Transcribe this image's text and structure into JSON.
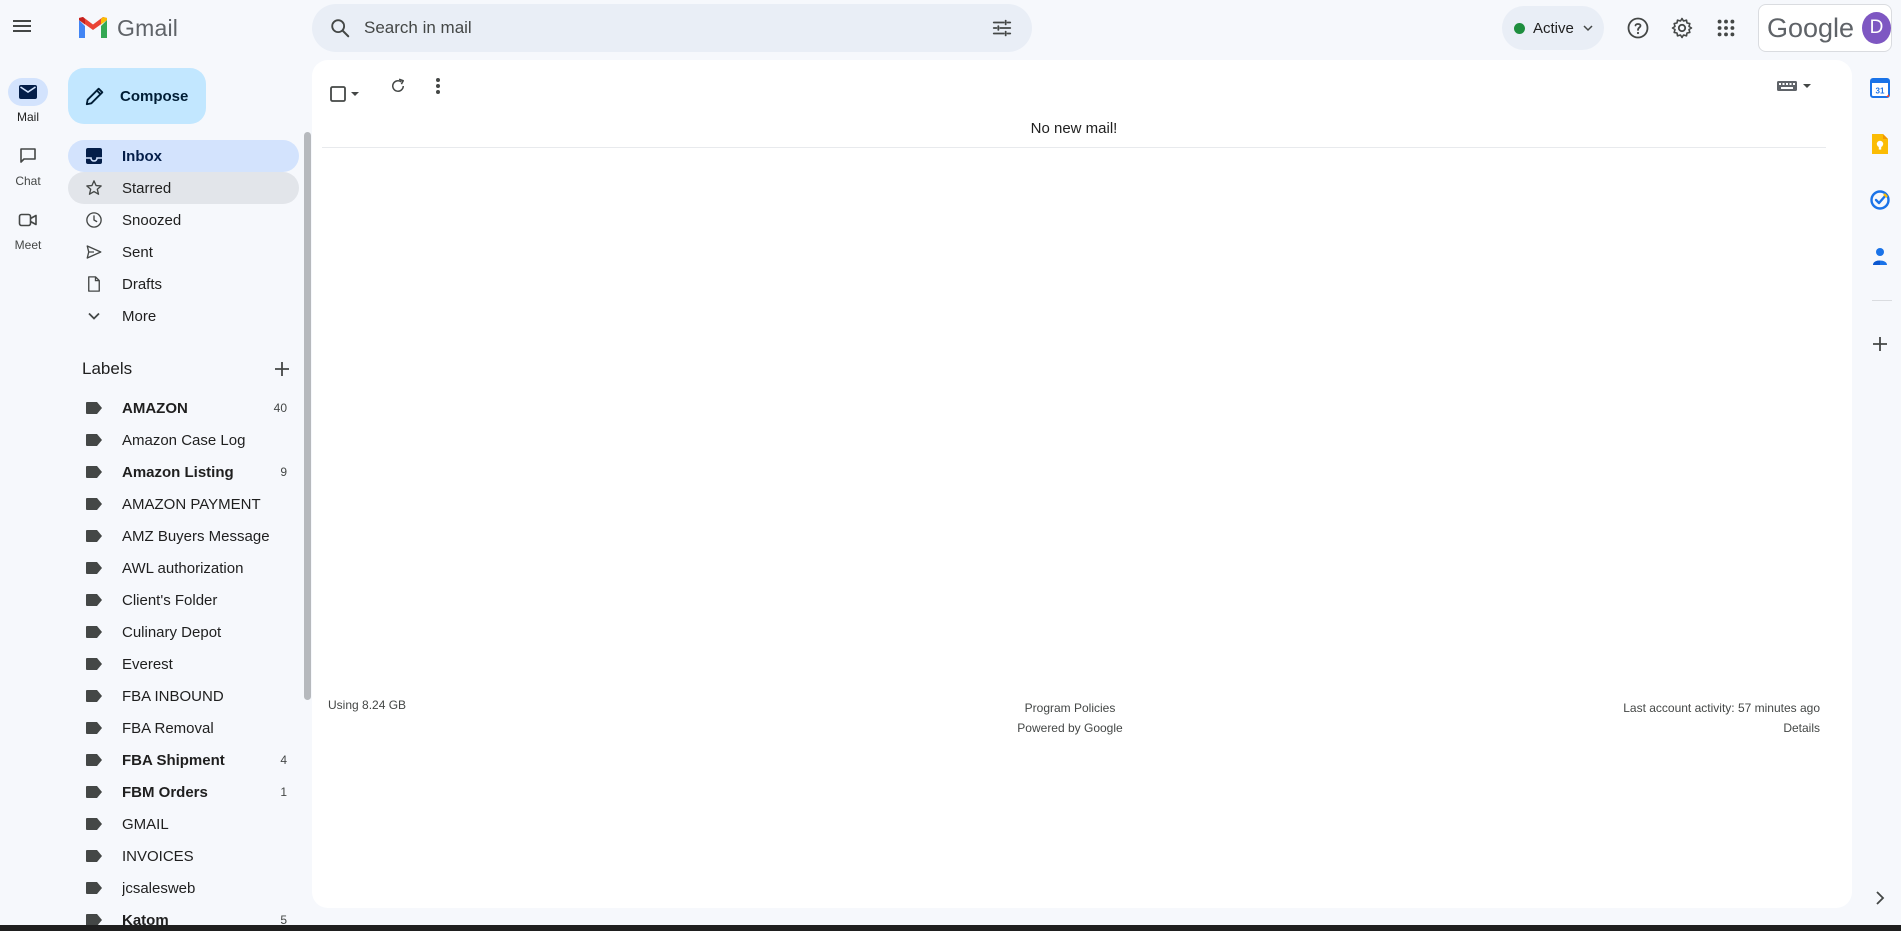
{
  "header": {
    "app_name": "Gmail",
    "search_placeholder": "Search in mail",
    "status_label": "Active",
    "google_wordmark": "Google",
    "avatar_initial": "D"
  },
  "rail": [
    {
      "label": "Mail",
      "icon": "mail-icon",
      "active": true
    },
    {
      "label": "Chat",
      "icon": "chat-icon",
      "active": false
    },
    {
      "label": "Meet",
      "icon": "meet-icon",
      "active": false
    }
  ],
  "nav": {
    "compose_label": "Compose",
    "items": [
      {
        "label": "Inbox",
        "icon": "inbox-icon"
      },
      {
        "label": "Starred",
        "icon": "star-icon"
      },
      {
        "label": "Snoozed",
        "icon": "clock-icon"
      },
      {
        "label": "Sent",
        "icon": "send-icon"
      },
      {
        "label": "Drafts",
        "icon": "draft-icon"
      },
      {
        "label": "More",
        "icon": "chevron-down-icon"
      }
    ]
  },
  "labels": {
    "heading": "Labels",
    "items": [
      {
        "name": "AMAZON",
        "count": "40",
        "bold": true
      },
      {
        "name": "Amazon Case Log",
        "count": "",
        "bold": false
      },
      {
        "name": "Amazon Listing",
        "count": "9",
        "bold": true
      },
      {
        "name": "AMAZON PAYMENT",
        "count": "",
        "bold": false
      },
      {
        "name": "AMZ Buyers Message",
        "count": "",
        "bold": false
      },
      {
        "name": "AWL authorization",
        "count": "",
        "bold": false
      },
      {
        "name": "Client's Folder",
        "count": "",
        "bold": false
      },
      {
        "name": "Culinary Depot",
        "count": "",
        "bold": false
      },
      {
        "name": "Everest",
        "count": "",
        "bold": false
      },
      {
        "name": "FBA INBOUND",
        "count": "",
        "bold": false
      },
      {
        "name": "FBA Removal",
        "count": "",
        "bold": false
      },
      {
        "name": "FBA Shipment",
        "count": "4",
        "bold": true
      },
      {
        "name": "FBM Orders",
        "count": "1",
        "bold": true
      },
      {
        "name": "GMAIL",
        "count": "",
        "bold": false
      },
      {
        "name": "INVOICES",
        "count": "",
        "bold": false
      },
      {
        "name": "jcsalesweb",
        "count": "",
        "bold": false
      },
      {
        "name": "Katom",
        "count": "5",
        "bold": true
      }
    ]
  },
  "main": {
    "empty_message": "No new mail!",
    "footer": {
      "usage": "Using 8.24 GB",
      "program_policies": "Program Policies",
      "powered_by": "Powered by Google",
      "last_activity": "Last account activity: 57 minutes ago",
      "details": "Details"
    }
  },
  "side_panel": {
    "calendar_day": "31",
    "apps": [
      "calendar-icon",
      "keep-icon",
      "tasks-icon",
      "contacts-icon",
      "add-icon"
    ]
  }
}
